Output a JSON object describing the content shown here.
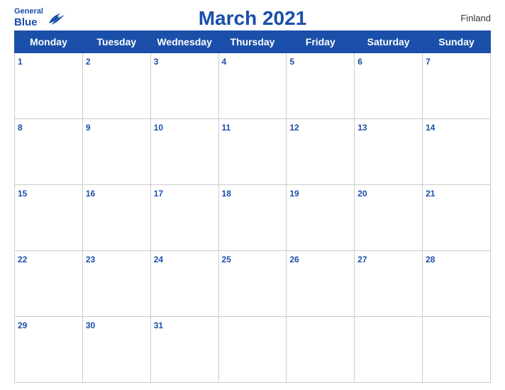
{
  "logo": {
    "general": "General",
    "blue": "Blue"
  },
  "title": "March 2021",
  "country": "Finland",
  "days": [
    "Monday",
    "Tuesday",
    "Wednesday",
    "Thursday",
    "Friday",
    "Saturday",
    "Sunday"
  ],
  "weeks": [
    [
      1,
      2,
      3,
      4,
      5,
      6,
      7
    ],
    [
      8,
      9,
      10,
      11,
      12,
      13,
      14
    ],
    [
      15,
      16,
      17,
      18,
      19,
      20,
      21
    ],
    [
      22,
      23,
      24,
      25,
      26,
      27,
      28
    ],
    [
      29,
      30,
      31,
      null,
      null,
      null,
      null
    ]
  ]
}
